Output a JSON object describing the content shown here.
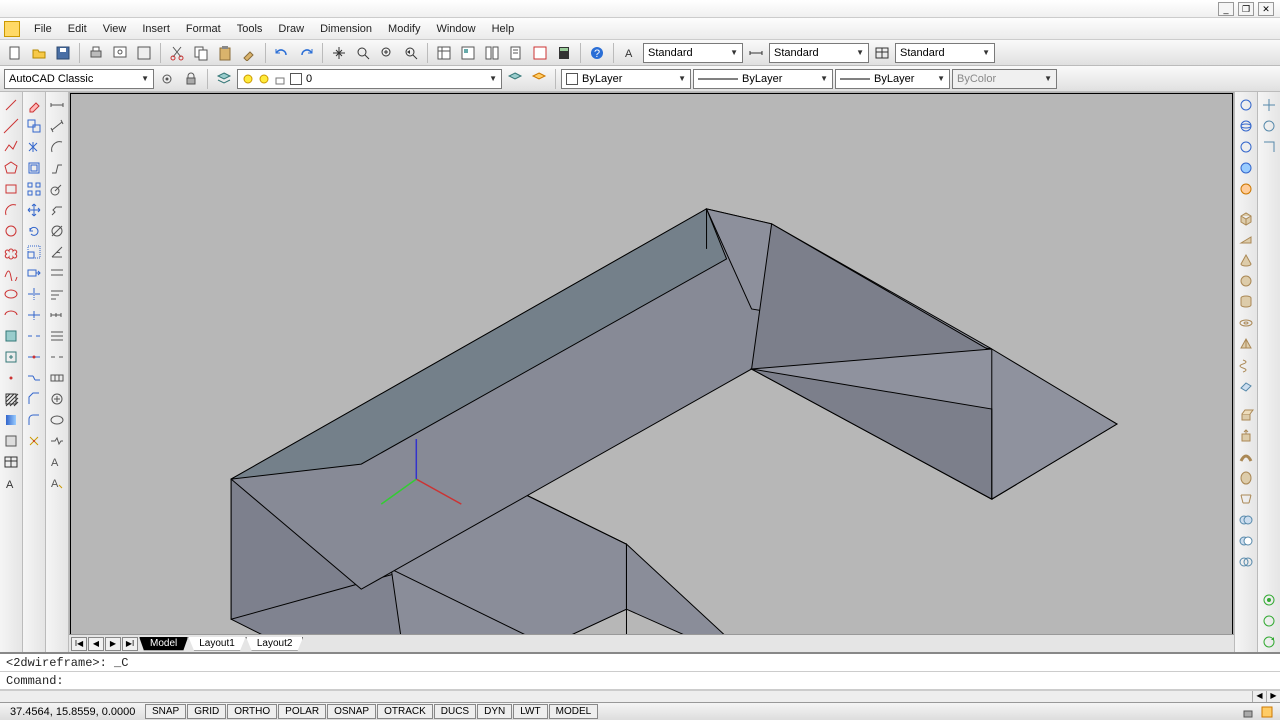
{
  "window": {
    "min": "_",
    "restore": "❐",
    "close": "✕"
  },
  "menu": [
    "File",
    "Edit",
    "View",
    "Insert",
    "Format",
    "Tools",
    "Draw",
    "Dimension",
    "Modify",
    "Window",
    "Help"
  ],
  "styles": {
    "text_style": "Standard",
    "dim_style": "Standard",
    "table_style": "Standard"
  },
  "workspace": "AutoCAD Classic",
  "layer": {
    "current": "0"
  },
  "props": {
    "color": "ByLayer",
    "linetype": "ByLayer",
    "lineweight": "ByLayer",
    "plot_style": "ByColor"
  },
  "tabs": {
    "active": "Model",
    "others": [
      "Layout1",
      "Layout2"
    ]
  },
  "command": {
    "line1": "<2dwireframe>: _C",
    "line2": "Command:"
  },
  "status": {
    "coords": "37.4564, 15.8559, 0.0000",
    "toggles": [
      "SNAP",
      "GRID",
      "ORTHO",
      "POLAR",
      "OSNAP",
      "OTRACK",
      "DUCS",
      "DYN",
      "LWT",
      "MODEL"
    ]
  }
}
